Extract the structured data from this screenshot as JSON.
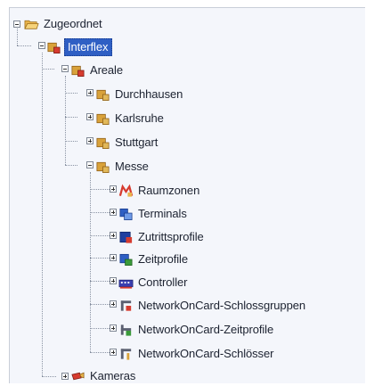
{
  "tree": {
    "root": "Zugeordnet",
    "interflex": "Interflex",
    "areale": "Areale",
    "durchhausen": "Durchhausen",
    "karlsruhe": "Karlsruhe",
    "stuttgart": "Stuttgart",
    "messe": "Messe",
    "raumzonen": "Raumzonen",
    "terminals": "Terminals",
    "zutrittsprofile": "Zutrittsprofile",
    "zeitprofile": "Zeitprofile",
    "controller": "Controller",
    "schlossgruppen": "NetworkOnCard-Schlossgruppen",
    "noc_zeitprofile": "NetworkOnCard-Zeitprofile",
    "schloesser": "NetworkOnCard-Schlösser",
    "kameras": "Kameras"
  },
  "icons": {
    "root": "open-folder-icon",
    "interflex": "site-icon",
    "area": "area-icon",
    "raumzonen": "room-zone-icon",
    "terminals": "terminal-icon",
    "zutrittsprofile": "access-profile-icon",
    "zeitprofile": "time-profile-icon",
    "controller": "controller-icon",
    "noc": "network-on-card-icon",
    "kameras": "camera-icon"
  },
  "colors": {
    "selection": "#2f5fc4",
    "folder": "#e9b44c",
    "area": "#d9a23a",
    "accent_red": "#d63b2f",
    "accent_blue": "#2f5fc4",
    "accent_green": "#3a9a3a"
  }
}
